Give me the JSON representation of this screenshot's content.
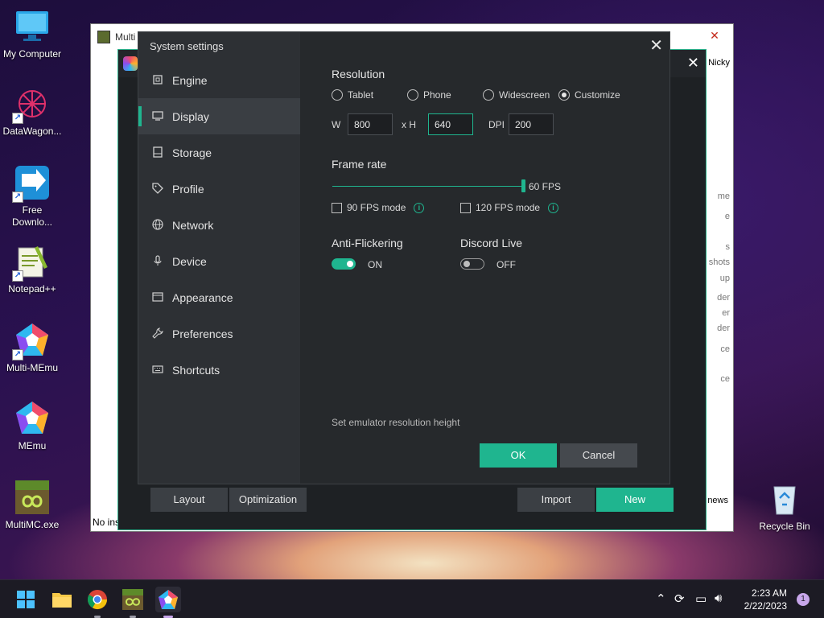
{
  "desktop": {
    "icons": [
      {
        "label": "My Computer"
      },
      {
        "label": "DataWagon..."
      },
      {
        "label": "Free Downlo..."
      },
      {
        "label": "Notepad++"
      },
      {
        "label": "Multi-MEmu"
      },
      {
        "label": "MEmu"
      },
      {
        "label": "MultiMC.exe"
      },
      {
        "label": "Recycle Bin"
      }
    ]
  },
  "background_window": {
    "title": "Multi",
    "user": "Nicky",
    "side_fragments": [
      "me",
      "e",
      "s",
      "shots",
      "up",
      "der",
      "er",
      "der",
      "ce",
      "ce"
    ],
    "news_label": "news",
    "status_text": "No ins"
  },
  "memu": {
    "buttons": {
      "layout": "Layout",
      "optimization": "Optimization",
      "import": "Import",
      "new": "New"
    }
  },
  "dialog": {
    "title": "System settings",
    "nav": [
      {
        "label": "Engine",
        "icon": "chip-icon"
      },
      {
        "label": "Display",
        "icon": "monitor-icon",
        "active": true
      },
      {
        "label": "Storage",
        "icon": "storage-icon"
      },
      {
        "label": "Profile",
        "icon": "tag-icon"
      },
      {
        "label": "Network",
        "icon": "globe-icon"
      },
      {
        "label": "Device",
        "icon": "microphone-icon"
      },
      {
        "label": "Appearance",
        "icon": "window-icon"
      },
      {
        "label": "Preferences",
        "icon": "wrench-icon"
      },
      {
        "label": "Shortcuts",
        "icon": "keyboard-icon"
      }
    ],
    "resolution": {
      "title": "Resolution",
      "options": [
        "Tablet",
        "Phone",
        "Widescreen",
        "Customize"
      ],
      "selected": "Customize",
      "w_label": "W",
      "width": "800",
      "h_label": "x H",
      "height": "640",
      "dpi_label": "DPI",
      "dpi": "200"
    },
    "frame_rate": {
      "title": "Frame rate",
      "value_label": "60 FPS",
      "level": 1.0,
      "fps90": "90 FPS mode",
      "fps120": "120 FPS mode"
    },
    "anti_flickering": {
      "title": "Anti-Flickering",
      "state": "ON"
    },
    "discord_live": {
      "title": "Discord Live",
      "state": "OFF"
    },
    "hint": "Set emulator resolution height",
    "ok": "OK",
    "cancel": "Cancel"
  },
  "taskbar": {
    "time": "2:23 AM",
    "date": "2/22/2023",
    "notifications": "1"
  },
  "colors": {
    "accent": "#1fb58f",
    "dialog_bg": "#26292c",
    "sidebar_bg": "#2d3034"
  }
}
